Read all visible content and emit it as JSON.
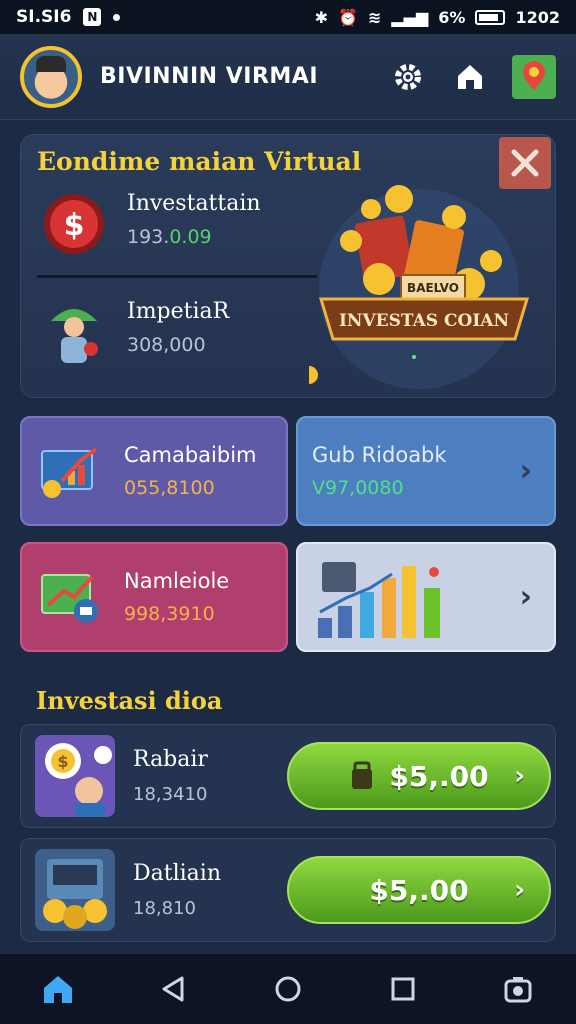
{
  "status_bar": {
    "time_left": "SI.SI6",
    "app_icon": "N",
    "battery": "6%",
    "time_right": "1202"
  },
  "header": {
    "title": "BIVINNIN VIRMAI",
    "icons": [
      "settings-icon",
      "home-icon",
      "map-icon"
    ]
  },
  "hero": {
    "title": "Eondime maian Virtual",
    "rows": [
      {
        "label": "Investattain",
        "value_prefix": "193.",
        "value_highlight": "0.09"
      },
      {
        "label": "ImpetiaR",
        "value": "308,000"
      }
    ],
    "art_sign": "INVESTAS COIAN",
    "art_tag": "BAELVO"
  },
  "tiles": [
    {
      "label": "Camabaibim",
      "value": "055,8100"
    },
    {
      "label": "Gub Ridoabk",
      "value": "V97,0080"
    },
    {
      "label": "Namleiole",
      "value": "998,3910"
    },
    {
      "label": "",
      "value": ""
    }
  ],
  "section": {
    "title": "Investasi dioa",
    "items": [
      {
        "label": "Rabair",
        "value": "18,3410",
        "button": "$5,.00"
      },
      {
        "label": "Datliain",
        "value": "18,810",
        "button": "$5,.00"
      }
    ]
  },
  "colors": {
    "background": "#1d2a44",
    "accent_yellow": "#f6d23a",
    "button_green": "#6cc12c"
  }
}
